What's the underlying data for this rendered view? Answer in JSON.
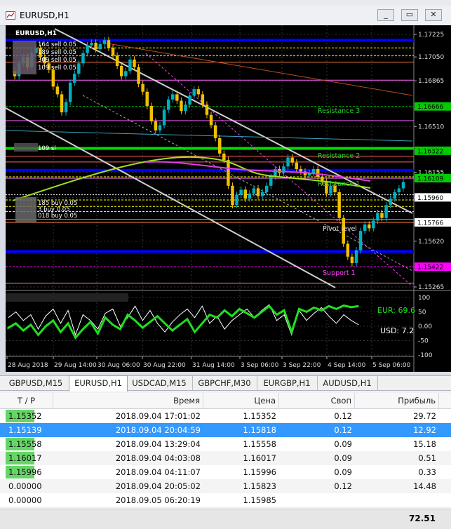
{
  "window": {
    "title": "EURUSD,H1",
    "buttons": [
      "_",
      "▭",
      "✕"
    ]
  },
  "chart": {
    "symbol_label": "EURUSD,H1",
    "price_axis": [
      {
        "label": "1.17225",
        "price": 1.17225
      },
      {
        "label": "1.17050",
        "price": 1.1705
      },
      {
        "label": "1.16865",
        "price": 1.16865
      },
      {
        "label": "1.16510",
        "price": 1.1651
      },
      {
        "label": "1.16155",
        "price": 1.16155
      },
      {
        "label": "1.15960",
        "price": 1.1596
      },
      {
        "label": "1.15620",
        "price": 1.1562
      },
      {
        "label": "1.15265",
        "price": 1.15265
      }
    ],
    "highlighted_prices": [
      {
        "label": "1.16666",
        "bg": "#00cc00",
        "fg": "#000000"
      },
      {
        "label": "1.16322",
        "bg": "#00cc00",
        "fg": "#000000"
      },
      {
        "label": "1.16109",
        "bg": "#00cc00",
        "fg": "#000000"
      },
      {
        "label": "1.15960",
        "bg": "#ffffff",
        "fg": "#000000"
      },
      {
        "label": "1.15766",
        "bg": "#ffffff",
        "fg": "#000000"
      },
      {
        "label": "1.15422",
        "bg": "#ff00ff",
        "fg": "#000000"
      }
    ],
    "level_labels": [
      "Resistance 3",
      "Resistance 2",
      "Resistance 1",
      "Pivot level",
      "Support 1"
    ],
    "order_labels": [
      "164 sell 0.05",
      "189 sell 0.05",
      "309 sell 0.05",
      "109 sell 0.05",
      "109 sl",
      "185 buy 0.05",
      "3 buy 0.05",
      "018 buy 0.05"
    ],
    "time_axis": [
      "28 Aug 2018",
      "29 Aug 14:00",
      "30 Aug 06:00",
      "30 Aug 22:00",
      "31 Aug 14:00",
      "3 Sep 06:00",
      "3 Sep 22:00",
      "4 Sep 14:00",
      "5 Sep 06:00"
    ],
    "indicator": {
      "eur_label": "EUR: 69.6",
      "usd_label": "USD: 7.2",
      "axis": [
        "100",
        "50",
        "0.00",
        "-50",
        "-100"
      ]
    }
  },
  "tabs": [
    {
      "label": "GBPUSD,M15",
      "active": false
    },
    {
      "label": "EURUSD,H1",
      "active": true
    },
    {
      "label": "USDCAD,M15",
      "active": false
    },
    {
      "label": "GBPCHF,M30",
      "active": false
    },
    {
      "label": "EURGBP,H1",
      "active": false
    },
    {
      "label": "AUDUSD,H1",
      "active": false
    }
  ],
  "table": {
    "headers": [
      "T / P",
      "Время",
      "Цена",
      "Своп",
      "Прибыль"
    ],
    "rows": [
      {
        "tp": "1.15352",
        "time": "2018.09.04 17:01:02",
        "price": "1.15352",
        "swap": "0.12",
        "profit": "29.72",
        "tp_green": true,
        "selected": false
      },
      {
        "tp": "1.15139",
        "time": "2018.09.04 20:04:59",
        "price": "1.15818",
        "swap": "0.12",
        "profit": "12.92",
        "tp_green": false,
        "selected": true
      },
      {
        "tp": "1.15558",
        "time": "2018.09.04 13:29:04",
        "price": "1.15558",
        "swap": "0.09",
        "profit": "15.18",
        "tp_green": true,
        "selected": false
      },
      {
        "tp": "1.16017",
        "time": "2018.09.04 04:03:08",
        "price": "1.16017",
        "swap": "0.09",
        "profit": "0.51",
        "tp_green": true,
        "selected": false
      },
      {
        "tp": "1.15996",
        "time": "2018.09.04 04:11:07",
        "price": "1.15996",
        "swap": "0.09",
        "profit": "0.33",
        "tp_green": true,
        "selected": false
      },
      {
        "tp": "0.00000",
        "time": "2018.09.04 20:05:02",
        "price": "1.15823",
        "swap": "0.12",
        "profit": "14.48",
        "tp_green": false,
        "selected": false
      },
      {
        "tp": "0.00000",
        "time": "2018.09.05 06:20:19",
        "price": "1.15985",
        "swap": "",
        "profit": "",
        "tp_green": false,
        "selected": false
      }
    ],
    "total": "72.51"
  },
  "colors": {
    "chart_bg": "#000000",
    "candle": "#f0c000",
    "candle_alt": "#00b0c0",
    "blue_line": "#0000ff",
    "green_line": "#00dd00",
    "selected_row": "#3399ff"
  }
}
